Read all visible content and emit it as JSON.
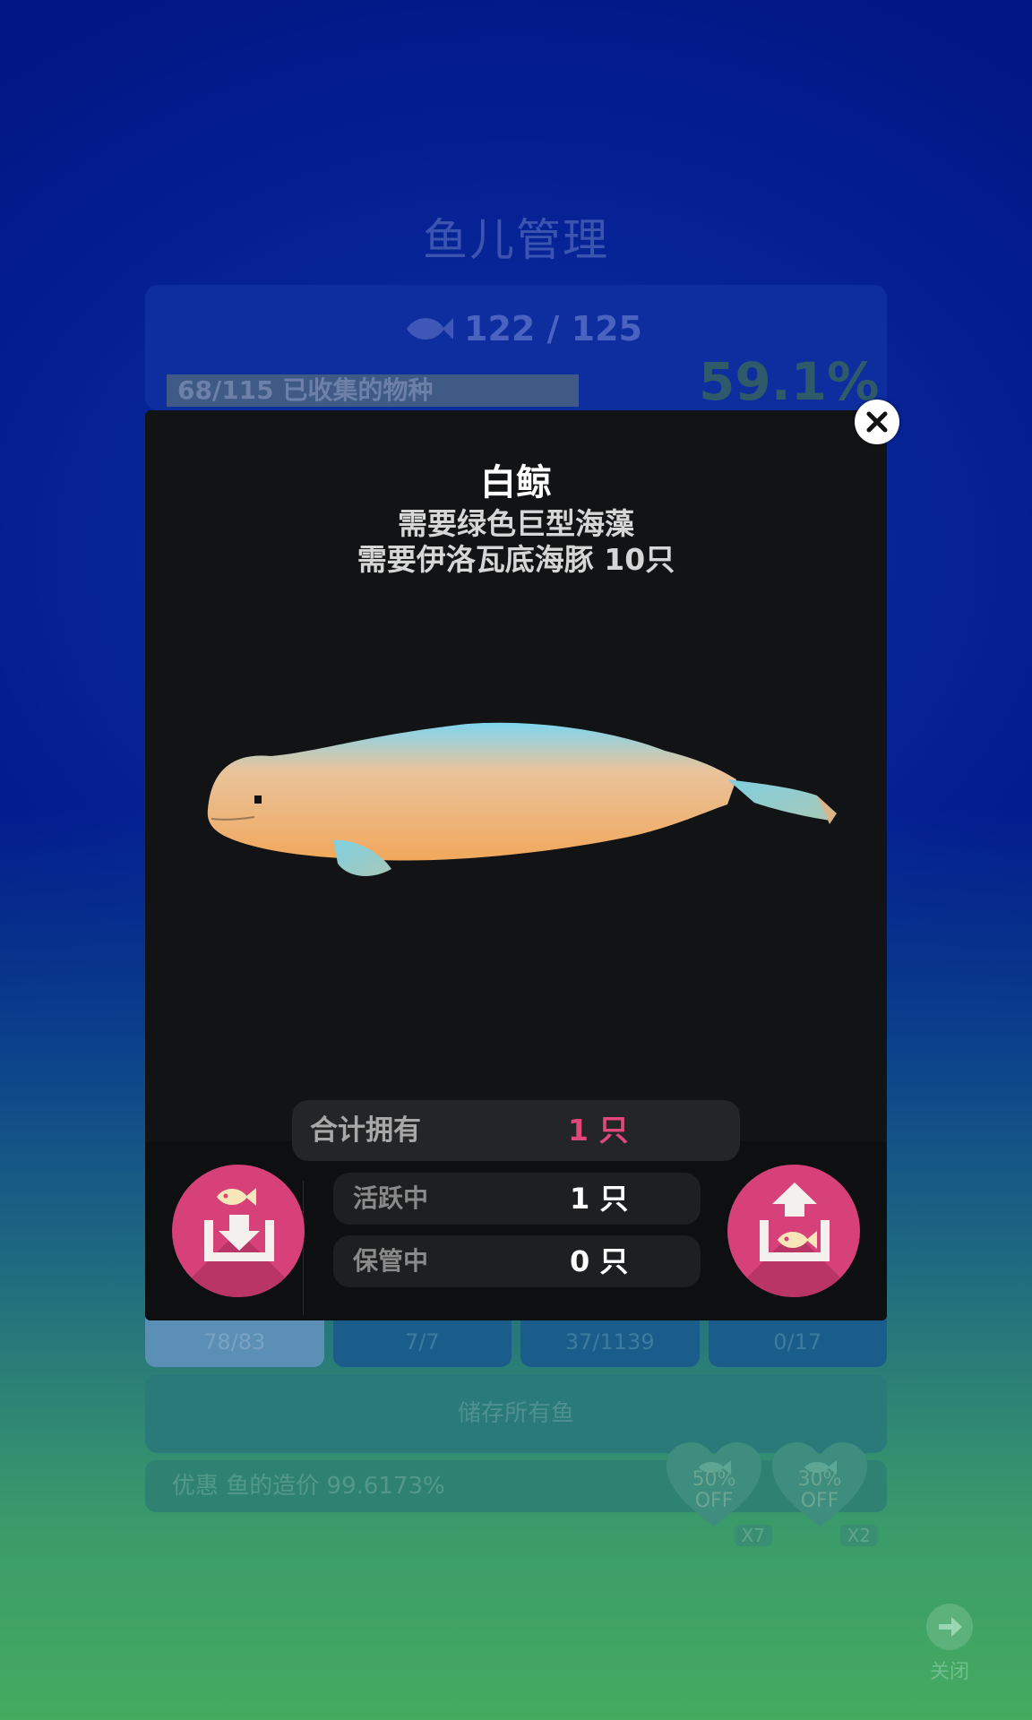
{
  "background": {
    "title": "鱼儿管理",
    "fish_count": "122 / 125",
    "collected": "68/115 已收集的物种",
    "percent": "59.1%",
    "tabs": [
      "78/83",
      "7/7",
      "37/1139",
      "0/17"
    ],
    "store_all": "储存所有鱼",
    "discount": "优惠 鱼的造价 99.6173%",
    "coupons": [
      {
        "pct": "50%",
        "off": "OFF",
        "qty": "X7"
      },
      {
        "pct": "30%",
        "off": "OFF",
        "qty": "X2"
      }
    ],
    "close_label": "关闭"
  },
  "modal": {
    "name": "白鲸",
    "requirements": [
      "需要绿色巨型海藻",
      "需要伊洛瓦底海豚 10只"
    ],
    "total_label": "合计拥有",
    "total_value": "1 只",
    "active_label": "活跃中",
    "active_value": "1 只",
    "stored_label": "保管中",
    "stored_value": "0 只"
  },
  "colors": {
    "accent": "#d7417a",
    "total_value": "#e0487a",
    "modal_bg": "#121314"
  },
  "icons": [
    "close-icon",
    "fish-icon",
    "store-fish-icon",
    "release-fish-icon",
    "heart-icon",
    "arrow-right-icon"
  ]
}
